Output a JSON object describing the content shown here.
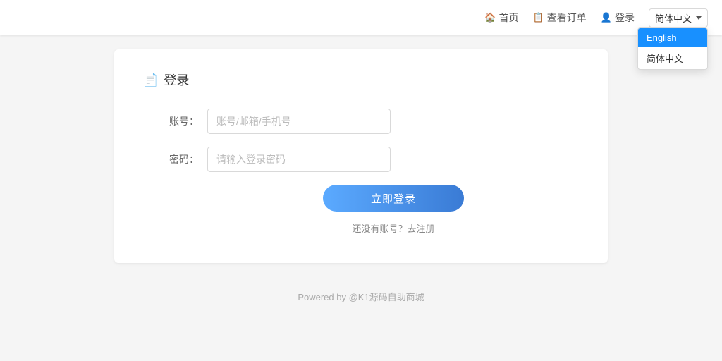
{
  "header": {
    "nav": [
      {
        "id": "home",
        "label": "首页",
        "icon": "home-icon"
      },
      {
        "id": "orders",
        "label": "查看订单",
        "icon": "orders-icon"
      },
      {
        "id": "login",
        "label": "登录",
        "icon": "user-icon"
      }
    ],
    "language": {
      "current": "简体中文",
      "options": [
        {
          "value": "en",
          "label": "English",
          "active": true
        },
        {
          "value": "zh",
          "label": "简体中文",
          "active": false
        }
      ]
    }
  },
  "login": {
    "title": "登录",
    "fields": {
      "account": {
        "label": "账号：",
        "placeholder": "账号/邮箱/手机号"
      },
      "password": {
        "label": "密码：",
        "placeholder": "请输入登录密码"
      }
    },
    "submit_label": "立即登录",
    "register_text": "还没有账号？去注册"
  },
  "footer": {
    "text": "Powered by @K1源码自助商城"
  }
}
